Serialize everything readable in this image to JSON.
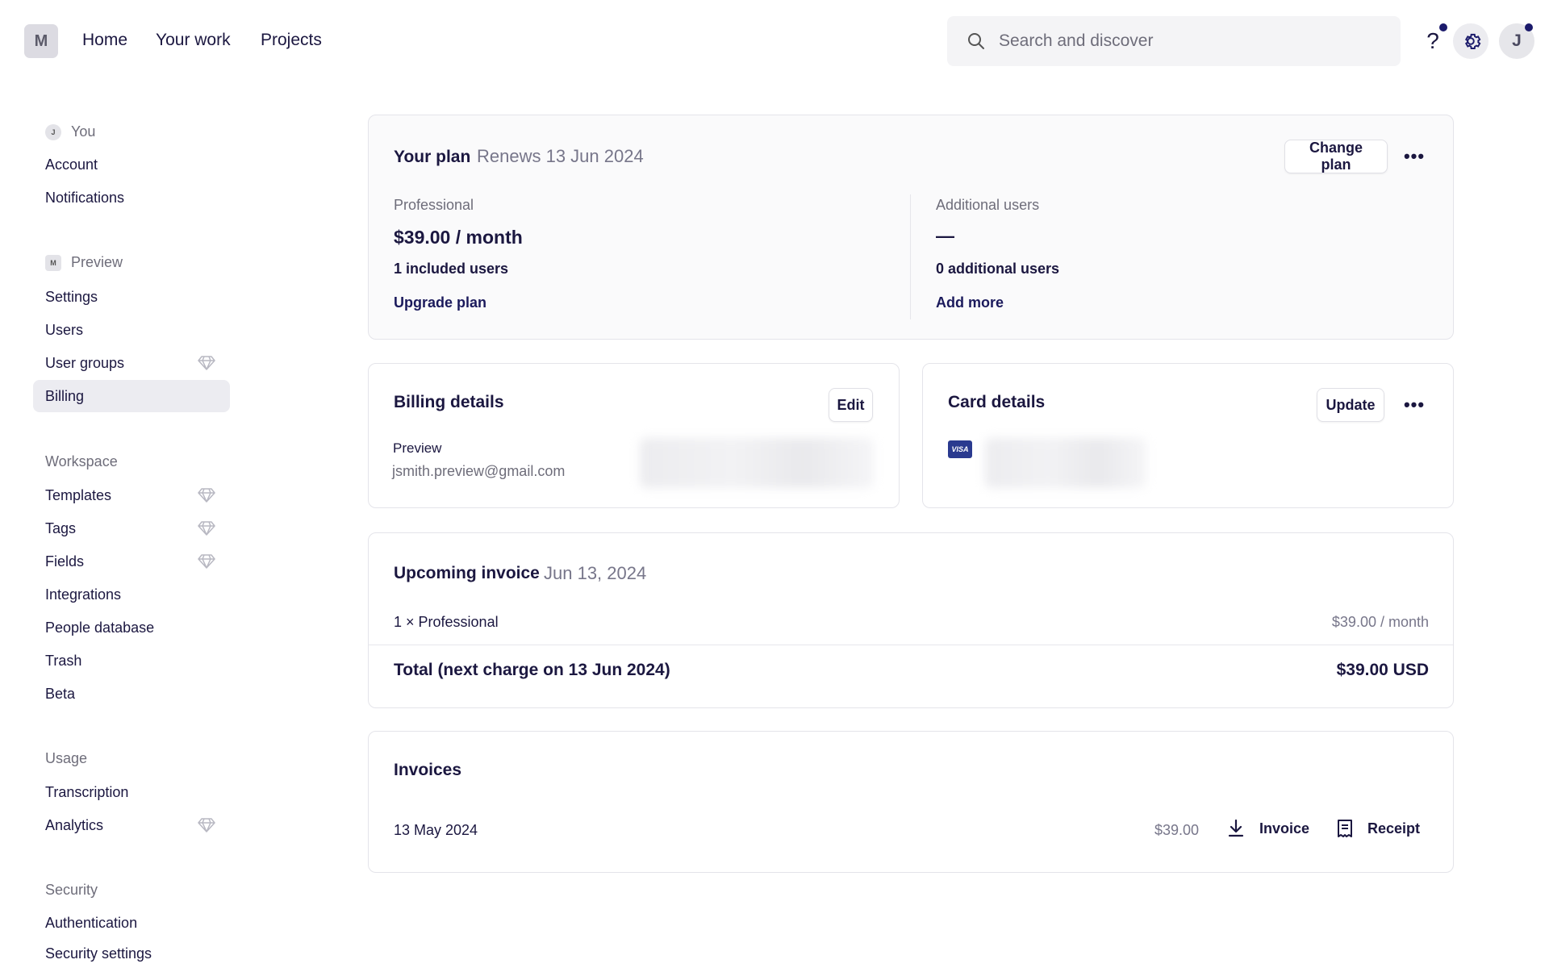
{
  "topnav": {
    "logo": "M",
    "links": [
      "Home",
      "Your work",
      "Projects"
    ],
    "search_placeholder": "Search and discover",
    "help": "?",
    "avatar": "J"
  },
  "sidebar": {
    "you": {
      "avatar": "J",
      "header": "You",
      "items": [
        "Account",
        "Notifications"
      ]
    },
    "preview": {
      "avatar": "M",
      "header": "Preview",
      "items": [
        "Settings",
        "Users",
        "User groups",
        "Billing"
      ]
    },
    "workspace": {
      "header": "Workspace",
      "items": [
        "Templates",
        "Tags",
        "Fields",
        "Integrations",
        "People database",
        "Trash",
        "Beta"
      ]
    },
    "usage": {
      "header": "Usage",
      "items": [
        "Transcription",
        "Analytics"
      ]
    },
    "security": {
      "header": "Security",
      "items": [
        "Authentication",
        "Security settings"
      ]
    },
    "active": "Billing",
    "premium_icon": "diamond-icon"
  },
  "plan": {
    "title": "Your plan",
    "renews": "Renews 13 Jun 2024",
    "change_plan": "Change plan",
    "left": {
      "label": "Professional",
      "price": "$39.00 / month",
      "users": "1 included users",
      "action": "Upgrade plan"
    },
    "right": {
      "label": "Additional users",
      "price": "—",
      "users": "0 additional users",
      "action": "Add more"
    }
  },
  "billing_details": {
    "title": "Billing details",
    "edit": "Edit",
    "name": "Preview",
    "email": "jsmith.preview@gmail.com"
  },
  "card_details": {
    "title": "Card details",
    "update": "Update",
    "brand": "VISA"
  },
  "upcoming_invoice": {
    "title": "Upcoming invoice",
    "date": "Jun 13, 2024",
    "line_item": "1 × Professional",
    "line_price": "$39.00 / month",
    "total_label": "Total (next charge on 13 Jun 2024)",
    "total_value": "$39.00 USD"
  },
  "invoices": {
    "title": "Invoices",
    "rows": [
      {
        "date": "13 May 2024",
        "amount": "$39.00",
        "invoice": "Invoice",
        "receipt": "Receipt"
      }
    ]
  },
  "colors": {
    "accent": "#1b1a6b",
    "active_bg": "#ececf1"
  }
}
